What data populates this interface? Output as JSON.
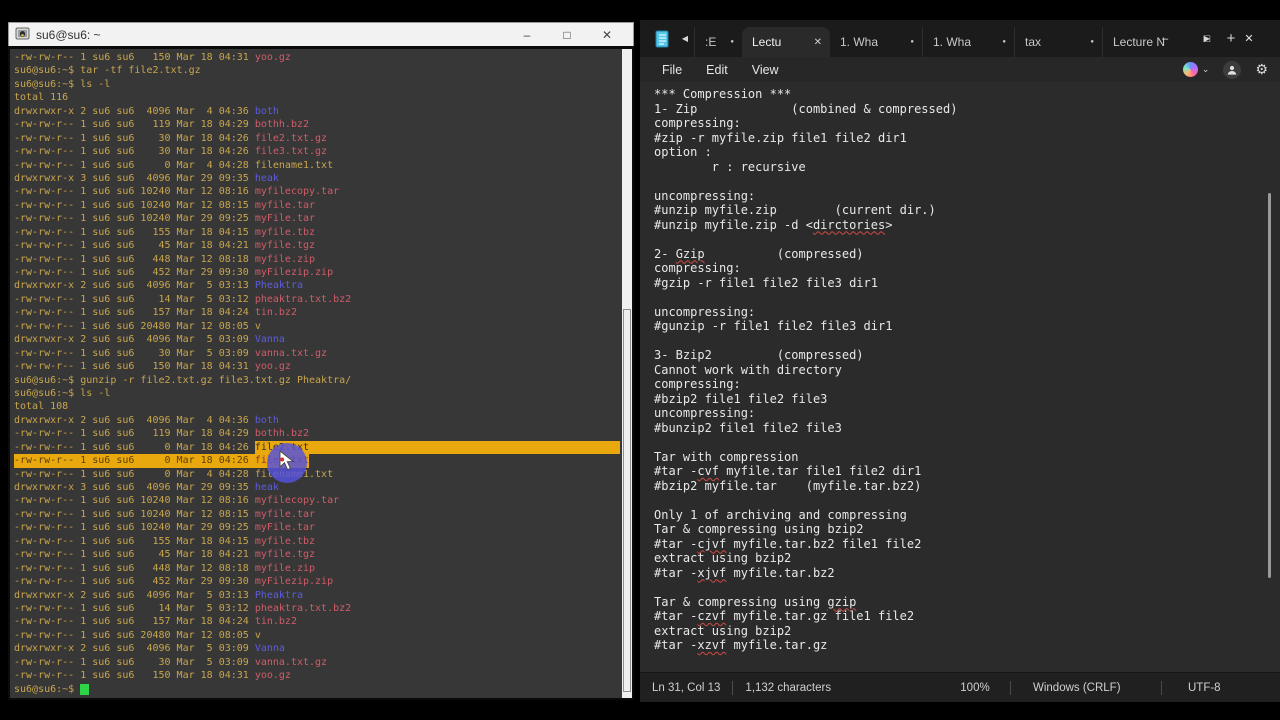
{
  "colors": {
    "terminal_bg": "#373737",
    "terminal_fg": "#c9a64d",
    "archive_red": "#d05c68",
    "dir_blue": "#5c5ce0",
    "selection_gold": "#e9a80e",
    "cursor_green": "#2fd348",
    "click_overlay_purple": "#5652de",
    "notepad_bg": "#2b2b2b",
    "tabbar_bg": "#1b1b1b",
    "squiggle_red": "#d14a44",
    "term_titlebar": "#f2f2f2"
  },
  "icons": {
    "terminal_app": "terminal-app-icon",
    "notepad_app": "notepad-app-icon",
    "minimize": "–",
    "maximize": "□",
    "close": "✕",
    "scroll_left": "◀",
    "scroll_right": "▶",
    "new_tab": "+",
    "unsaved_dot": "●",
    "close_tab": "✕",
    "chevron_down": "⌄",
    "settings_gear": "⚙"
  },
  "terminal": {
    "title": "su6@su6: ~",
    "controls": {
      "minimize": "–",
      "maximize": "□",
      "close": "✕"
    },
    "lines": [
      {
        "s": [
          [
            "-rw-rw-r-- 1 su6 su6   150 Mar 18 04:31 ",
            "y"
          ],
          [
            "yoo.gz",
            "r"
          ]
        ]
      },
      {
        "s": [
          [
            "su6@su6:~$ tar -tf file2.txt.gz",
            "y"
          ]
        ]
      },
      {
        "s": [
          [
            "su6@su6:~$ ls -l",
            "y"
          ]
        ]
      },
      {
        "s": [
          [
            "total 116",
            "y"
          ]
        ]
      },
      {
        "s": [
          [
            "drwxrwxr-x 2 su6 su6  4096 Mar  4 04:36 ",
            "y"
          ],
          [
            "both",
            "b"
          ]
        ]
      },
      {
        "s": [
          [
            "-rw-rw-r-- 1 su6 su6   119 Mar 18 04:29 ",
            "y"
          ],
          [
            "bothh.bz2",
            "r"
          ]
        ]
      },
      {
        "s": [
          [
            "-rw-rw-r-- 1 su6 su6    30 Mar 18 04:26 ",
            "y"
          ],
          [
            "file2.txt.gz",
            "r"
          ]
        ]
      },
      {
        "s": [
          [
            "-rw-rw-r-- 1 su6 su6    30 Mar 18 04:26 ",
            "y"
          ],
          [
            "file3.txt.gz",
            "r"
          ]
        ]
      },
      {
        "s": [
          [
            "-rw-rw-r-- 1 su6 su6     0 Mar  4 04:28 filename1.txt",
            "y"
          ]
        ]
      },
      {
        "s": [
          [
            "drwxrwxr-x 3 su6 su6  4096 Mar 29 09:35 ",
            "y"
          ],
          [
            "heak",
            "b"
          ]
        ]
      },
      {
        "s": [
          [
            "-rw-rw-r-- 1 su6 su6 10240 Mar 12 08:16 ",
            "y"
          ],
          [
            "myfilecopy.tar",
            "r"
          ]
        ]
      },
      {
        "s": [
          [
            "-rw-rw-r-- 1 su6 su6 10240 Mar 12 08:15 ",
            "y"
          ],
          [
            "myfile.tar",
            "r"
          ]
        ]
      },
      {
        "s": [
          [
            "-rw-rw-r-- 1 su6 su6 10240 Mar 29 09:25 ",
            "y"
          ],
          [
            "myFile.tar",
            "r"
          ]
        ]
      },
      {
        "s": [
          [
            "-rw-rw-r-- 1 su6 su6   155 Mar 18 04:15 ",
            "y"
          ],
          [
            "myfile.tbz",
            "r"
          ]
        ]
      },
      {
        "s": [
          [
            "-rw-rw-r-- 1 su6 su6    45 Mar 18 04:21 ",
            "y"
          ],
          [
            "myfile.tgz",
            "r"
          ]
        ]
      },
      {
        "s": [
          [
            "-rw-rw-r-- 1 su6 su6   448 Mar 12 08:18 ",
            "y"
          ],
          [
            "myfile.zip",
            "r"
          ]
        ]
      },
      {
        "s": [
          [
            "-rw-rw-r-- 1 su6 su6   452 Mar 29 09:30 ",
            "y"
          ],
          [
            "myFilezip.zip",
            "r"
          ]
        ]
      },
      {
        "s": [
          [
            "drwxrwxr-x 2 su6 su6  4096 Mar  5 03:13 ",
            "y"
          ],
          [
            "Pheaktra",
            "b"
          ]
        ]
      },
      {
        "s": [
          [
            "-rw-rw-r-- 1 su6 su6    14 Mar  5 03:12 ",
            "y"
          ],
          [
            "pheaktra.txt.bz2",
            "r"
          ]
        ]
      },
      {
        "s": [
          [
            "-rw-rw-r-- 1 su6 su6   157 Mar 18 04:24 ",
            "y"
          ],
          [
            "tin.bz2",
            "r"
          ]
        ]
      },
      {
        "s": [
          [
            "-rw-rw-r-- 1 su6 su6 20480 Mar 12 08:05 v",
            "y"
          ]
        ]
      },
      {
        "s": [
          [
            "drwxrwxr-x 2 su6 su6  4096 Mar  5 03:09 ",
            "y"
          ],
          [
            "Vanna",
            "b"
          ]
        ]
      },
      {
        "s": [
          [
            "-rw-rw-r-- 1 su6 su6    30 Mar  5 03:09 ",
            "y"
          ],
          [
            "vanna.txt.gz",
            "r"
          ]
        ]
      },
      {
        "s": [
          [
            "-rw-rw-r-- 1 su6 su6   150 Mar 18 04:31 ",
            "y"
          ],
          [
            "yoo.gz",
            "r"
          ]
        ]
      },
      {
        "s": [
          [
            "su6@su6:~$ gunzip -r file2.txt.gz file3.txt.gz Pheaktra/",
            "y"
          ]
        ]
      },
      {
        "s": [
          [
            "su6@su6:~$ ls -l",
            "y"
          ]
        ]
      },
      {
        "s": [
          [
            "total 108",
            "y"
          ]
        ]
      },
      {
        "s": [
          [
            "drwxrwxr-x 2 su6 su6  4096 Mar  4 04:36 ",
            "y"
          ],
          [
            "both",
            "b"
          ]
        ]
      },
      {
        "s": [
          [
            "-rw-rw-r-- 1 su6 su6   119 Mar 18 04:29 ",
            "y"
          ],
          [
            "bothh.bz2",
            "r"
          ]
        ]
      },
      {
        "s": [
          [
            "-rw-rw-r-- 1 su6 su6     0 Mar 18 04:26 ",
            "y"
          ],
          [
            "file2.txt",
            "hd"
          ]
        ],
        "fill": true
      },
      {
        "s": [
          [
            "-rw-rw-r-- 1 su6 su6     0 Mar 18 04:26 ",
            "hb"
          ],
          [
            "file3.txt",
            "hr"
          ]
        ]
      },
      {
        "s": [
          [
            "-rw-rw-r-- 1 su6 su6     0 Mar  4 04:28 filename1.txt",
            "y"
          ]
        ]
      },
      {
        "s": [
          [
            "drwxrwxr-x 3 su6 su6  4096 Mar 29 09:35 ",
            "y"
          ],
          [
            "heak",
            "b"
          ]
        ]
      },
      {
        "s": [
          [
            "-rw-rw-r-- 1 su6 su6 10240 Mar 12 08:16 ",
            "y"
          ],
          [
            "myfilecopy.tar",
            "r"
          ]
        ]
      },
      {
        "s": [
          [
            "-rw-rw-r-- 1 su6 su6 10240 Mar 12 08:15 ",
            "y"
          ],
          [
            "myfile.tar",
            "r"
          ]
        ]
      },
      {
        "s": [
          [
            "-rw-rw-r-- 1 su6 su6 10240 Mar 29 09:25 ",
            "y"
          ],
          [
            "myFile.tar",
            "r"
          ]
        ]
      },
      {
        "s": [
          [
            "-rw-rw-r-- 1 su6 su6   155 Mar 18 04:15 ",
            "y"
          ],
          [
            "myfile.tbz",
            "r"
          ]
        ]
      },
      {
        "s": [
          [
            "-rw-rw-r-- 1 su6 su6    45 Mar 18 04:21 ",
            "y"
          ],
          [
            "myfile.tgz",
            "r"
          ]
        ]
      },
      {
        "s": [
          [
            "-rw-rw-r-- 1 su6 su6   448 Mar 12 08:18 ",
            "y"
          ],
          [
            "myfile.zip",
            "r"
          ]
        ]
      },
      {
        "s": [
          [
            "-rw-rw-r-- 1 su6 su6   452 Mar 29 09:30 ",
            "y"
          ],
          [
            "myFilezip.zip",
            "r"
          ]
        ]
      },
      {
        "s": [
          [
            "drwxrwxr-x 2 su6 su6  4096 Mar  5 03:13 ",
            "y"
          ],
          [
            "Pheaktra",
            "b"
          ]
        ]
      },
      {
        "s": [
          [
            "-rw-rw-r-- 1 su6 su6    14 Mar  5 03:12 ",
            "y"
          ],
          [
            "pheaktra.txt.bz2",
            "r"
          ]
        ]
      },
      {
        "s": [
          [
            "-rw-rw-r-- 1 su6 su6   157 Mar 18 04:24 ",
            "y"
          ],
          [
            "tin.bz2",
            "r"
          ]
        ]
      },
      {
        "s": [
          [
            "-rw-rw-r-- 1 su6 su6 20480 Mar 12 08:05 v",
            "y"
          ]
        ]
      },
      {
        "s": [
          [
            "drwxrwxr-x 2 su6 su6  4096 Mar  5 03:09 ",
            "y"
          ],
          [
            "Vanna",
            "b"
          ]
        ]
      },
      {
        "s": [
          [
            "-rw-rw-r-- 1 su6 su6    30 Mar  5 03:09 ",
            "y"
          ],
          [
            "vanna.txt.gz",
            "r"
          ]
        ]
      },
      {
        "s": [
          [
            "-rw-rw-r-- 1 su6 su6   150 Mar 18 04:31 ",
            "y"
          ],
          [
            "yoo.gz",
            "r"
          ]
        ]
      },
      {
        "s": [
          [
            "su6@su6:~$ ",
            "y"
          ]
        ],
        "cursor": true
      }
    ]
  },
  "notepad": {
    "tabs": [
      {
        "label": ":E",
        "type": "partial",
        "unsaved": true
      },
      {
        "label": "Lectu",
        "type": "active",
        "unsaved": false
      },
      {
        "label": "1. Wha",
        "type": "mid",
        "unsaved": true
      },
      {
        "label": "1. Wha",
        "type": "mid",
        "unsaved": true
      },
      {
        "label": "tax",
        "type": "mid2",
        "unsaved": true
      },
      {
        "label": "Lecture N",
        "type": "last",
        "unsaved": false
      }
    ],
    "tabbar": {
      "scroll_left": "◀",
      "scroll_right": "▶",
      "new_tab": "+"
    },
    "controls": {
      "minimize": "–",
      "maximize": "□",
      "close": "✕"
    },
    "menu": [
      "File",
      "Edit",
      "View"
    ],
    "lines": [
      {
        "s": [
          [
            "*** Compression ***",
            "n"
          ]
        ]
      },
      {
        "s": [
          [
            "1- Zip             (combined & compressed)",
            "n"
          ]
        ]
      },
      {
        "s": [
          [
            "compressing:",
            "n"
          ]
        ]
      },
      {
        "s": [
          [
            "#zip -r myfile.zip file1 file2 dir1",
            "n"
          ]
        ]
      },
      {
        "s": [
          [
            "option :",
            "n"
          ]
        ]
      },
      {
        "s": [
          [
            "        r : recursive",
            "n"
          ]
        ]
      },
      {
        "s": [
          [
            "",
            "n"
          ]
        ]
      },
      {
        "s": [
          [
            "uncompressing:",
            "n"
          ]
        ]
      },
      {
        "s": [
          [
            "#unzip myfile.zip        (current dir.)",
            "n"
          ]
        ]
      },
      {
        "s": [
          [
            "#unzip myfile.zip -d <",
            "n"
          ],
          [
            "dirctories",
            "sp"
          ],
          [
            ">",
            "n"
          ]
        ]
      },
      {
        "s": [
          [
            "",
            "n"
          ]
        ]
      },
      {
        "s": [
          [
            "2- ",
            "n"
          ],
          [
            "Gzip",
            "sp"
          ],
          [
            "          (compressed)",
            "n"
          ]
        ]
      },
      {
        "s": [
          [
            "compressing:",
            "n"
          ]
        ]
      },
      {
        "s": [
          [
            "#gzip -r file1 file2 file3 dir1",
            "n"
          ]
        ]
      },
      {
        "s": [
          [
            "",
            "n"
          ]
        ]
      },
      {
        "s": [
          [
            "uncompressing:",
            "n"
          ]
        ]
      },
      {
        "s": [
          [
            "#gunzip -r file1 file2 file3 dir1",
            "n"
          ]
        ]
      },
      {
        "s": [
          [
            "",
            "n"
          ]
        ]
      },
      {
        "s": [
          [
            "3- Bzip2         (compressed)",
            "n"
          ]
        ]
      },
      {
        "s": [
          [
            "Cannot work with directory",
            "n"
          ]
        ]
      },
      {
        "s": [
          [
            "compressing:",
            "n"
          ]
        ]
      },
      {
        "s": [
          [
            "#bzip2 file1 file2 file3",
            "n"
          ]
        ]
      },
      {
        "s": [
          [
            "uncompressing:",
            "n"
          ]
        ]
      },
      {
        "s": [
          [
            "#bunzip2 file1 file2 file3",
            "n"
          ]
        ]
      },
      {
        "s": [
          [
            "",
            "n"
          ]
        ]
      },
      {
        "s": [
          [
            "Tar with compression",
            "n"
          ]
        ]
      },
      {
        "s": [
          [
            "#tar -",
            "n"
          ],
          [
            "cvf",
            "sp"
          ],
          [
            " myfile.tar file1 file2 dir1",
            "n"
          ]
        ]
      },
      {
        "s": [
          [
            "#bzip2 myfile.tar    (myfile.tar.bz2)",
            "n"
          ]
        ]
      },
      {
        "s": [
          [
            "",
            "n"
          ]
        ]
      },
      {
        "s": [
          [
            "Only 1 of archiving and compressing",
            "n"
          ]
        ]
      },
      {
        "s": [
          [
            "Tar & compressing using bzip2",
            "n"
          ]
        ]
      },
      {
        "s": [
          [
            "#tar -",
            "n"
          ],
          [
            "cjvf",
            "sp"
          ],
          [
            " myfile.tar.bz2 file1 file2",
            "n"
          ]
        ]
      },
      {
        "s": [
          [
            "extract using bzip2",
            "n"
          ]
        ]
      },
      {
        "s": [
          [
            "#tar -",
            "n"
          ],
          [
            "xjvf",
            "sp"
          ],
          [
            " myfile.tar.bz2",
            "n"
          ]
        ]
      },
      {
        "s": [
          [
            "",
            "n"
          ]
        ]
      },
      {
        "s": [
          [
            "Tar & compressing using ",
            "n"
          ],
          [
            "gzip",
            "sp"
          ]
        ]
      },
      {
        "s": [
          [
            "#tar -",
            "n"
          ],
          [
            "czvf",
            "sp"
          ],
          [
            " myfile.tar.gz file1 file2",
            "n"
          ]
        ]
      },
      {
        "s": [
          [
            "extract using bzip2",
            "n"
          ]
        ]
      },
      {
        "s": [
          [
            "#tar -",
            "n"
          ],
          [
            "xzvf",
            "sp"
          ],
          [
            " myfile.tar.gz",
            "n"
          ]
        ]
      }
    ],
    "status": {
      "line_col": "Ln 31, Col 13",
      "characters": "1,132 characters",
      "zoom": "100%",
      "eol": "Windows (CRLF)",
      "encoding": "UTF-8"
    }
  }
}
